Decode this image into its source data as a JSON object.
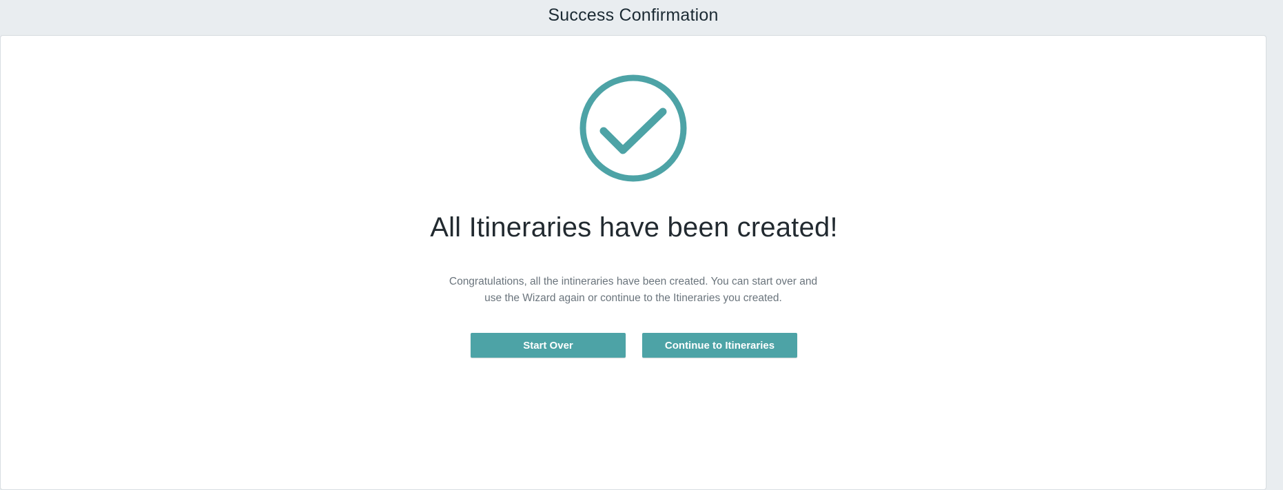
{
  "header": {
    "title": "Success Confirmation"
  },
  "success": {
    "icon": "check-circle-icon",
    "title": "All Itineraries have been created!",
    "message": "Congratulations, all the intineraries have been created. You can start over and use the Wizard again or continue to the Itineraries you created."
  },
  "actions": {
    "start_over_label": "Start Over",
    "continue_label": "Continue to Itineraries"
  },
  "colors": {
    "accent": "#4da3a6",
    "page_background": "#e9edf0",
    "card_background": "#ffffff"
  }
}
